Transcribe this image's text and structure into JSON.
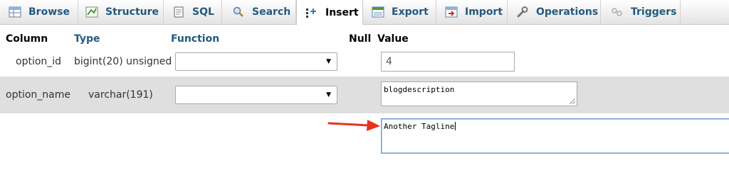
{
  "tabs": [
    {
      "label": "Browse",
      "icon": "browse-icon"
    },
    {
      "label": "Structure",
      "icon": "structure-icon"
    },
    {
      "label": "SQL",
      "icon": "sql-icon"
    },
    {
      "label": "Search",
      "icon": "search-icon"
    },
    {
      "label": "Insert",
      "icon": "insert-icon",
      "active": true
    },
    {
      "label": "Export",
      "icon": "export-icon"
    },
    {
      "label": "Import",
      "icon": "import-icon"
    },
    {
      "label": "Operations",
      "icon": "wrench-icon"
    },
    {
      "label": "Triggers",
      "icon": "triggers-icon"
    }
  ],
  "columns": {
    "column": "Column",
    "type": "Type",
    "function": "Function",
    "null": "Null",
    "value": "Value"
  },
  "rows": [
    {
      "column": "option_id",
      "type": "bigint(20) unsigned",
      "function": "",
      "value": "4"
    },
    {
      "column": "option_name",
      "type": "varchar(191)",
      "function": "",
      "value": "blogdescription"
    },
    {
      "column": "",
      "type": "",
      "function": "",
      "value": "Another Tagline"
    }
  ],
  "colors": {
    "link": "#235a81",
    "row_alt": "#dfdfdf",
    "annotation_arrow": "#e8321e"
  }
}
